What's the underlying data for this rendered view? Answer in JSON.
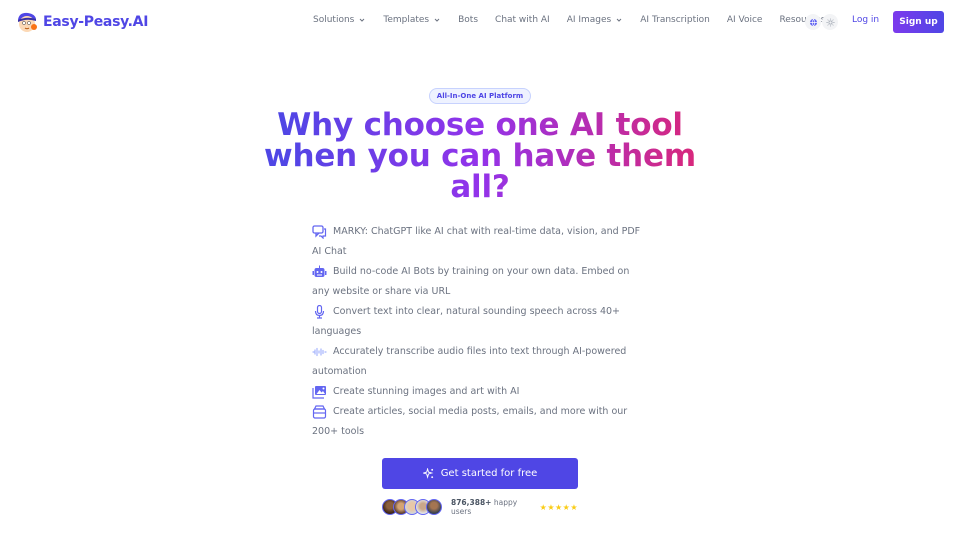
{
  "nav": {
    "brand": "Easy-Peasy.AI",
    "items": [
      {
        "label": "Solutions",
        "dropdown": true
      },
      {
        "label": "Templates",
        "dropdown": true
      },
      {
        "label": "Bots",
        "dropdown": false
      },
      {
        "label": "Chat with AI",
        "dropdown": false
      },
      {
        "label": "AI Images",
        "dropdown": true
      },
      {
        "label": "AI Transcription",
        "dropdown": false
      },
      {
        "label": "AI Voice",
        "dropdown": false
      },
      {
        "label": "Resources",
        "dropdown": true
      }
    ],
    "language_icon": "globe-icon",
    "theme_icon": "sun-icon",
    "login": "Log in",
    "signup": "Sign up"
  },
  "hero": {
    "badge": "All-In-One AI Platform",
    "headline_line1": "Why choose one AI tool",
    "headline_line2": "when you can have them",
    "headline_line3": "all?",
    "features": [
      {
        "icon": "chat-bubbles-icon",
        "text": "MARKY: ChatGPT like AI chat with real-time data, vision, and PDF AI Chat"
      },
      {
        "icon": "robot-icon",
        "text": "Build no-code AI Bots by training on your own data. Embed on any website or share via URL"
      },
      {
        "icon": "microphone-icon",
        "text": "Convert text into clear, natural sounding speech across 40+ languages"
      },
      {
        "icon": "waveform-icon",
        "text": "Accurately transcribe audio files into text through AI-powered automation"
      },
      {
        "icon": "images-icon",
        "text": "Create stunning images and art with AI"
      },
      {
        "icon": "stack-icon",
        "text": "Create articles, social media posts, emails, and more with our 200+ tools"
      }
    ],
    "cta": "Get started for free",
    "users_count": "876,388+",
    "users_label": "happy users",
    "rating_stars": 5,
    "stars_text": "★★★★★"
  },
  "colors": {
    "brand": "#4f46e5",
    "accent_purple": "#9333ea",
    "accent_pink": "#db2777",
    "star": "#facc15"
  }
}
